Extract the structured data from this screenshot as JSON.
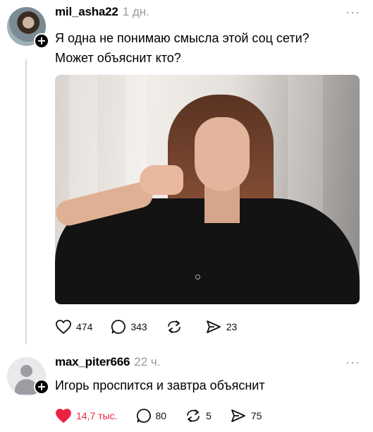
{
  "posts": [
    {
      "username": "mil_asha22",
      "time": "1 дн.",
      "more": "···",
      "text_lines": [
        "Я одна не понимаю смысла этой соц сети?",
        "Может объяснит кто?"
      ],
      "follow": "+",
      "has_image": true,
      "actions": {
        "likes": "474",
        "replies": "343",
        "reposts": "",
        "shares": "23"
      },
      "liked": false
    },
    {
      "username": "max_piter666",
      "time": "22 ч.",
      "more": "···",
      "text_lines": [
        "Игорь проспится и завтра объяснит"
      ],
      "follow": "+",
      "has_image": false,
      "actions": {
        "likes": "14,7 тыс.",
        "replies": "80",
        "reposts": "5",
        "shares": "75"
      },
      "liked": true
    }
  ],
  "icons": {
    "like": "heart-icon",
    "reply": "comment-bubble-icon",
    "repost": "repost-arrows-icon",
    "share": "send-arrow-icon",
    "more": "more-dots-icon",
    "follow": "plus-icon"
  },
  "colors": {
    "like_active": "#e8223f",
    "muted": "#999999",
    "thread_line": "#d9d9d9"
  }
}
